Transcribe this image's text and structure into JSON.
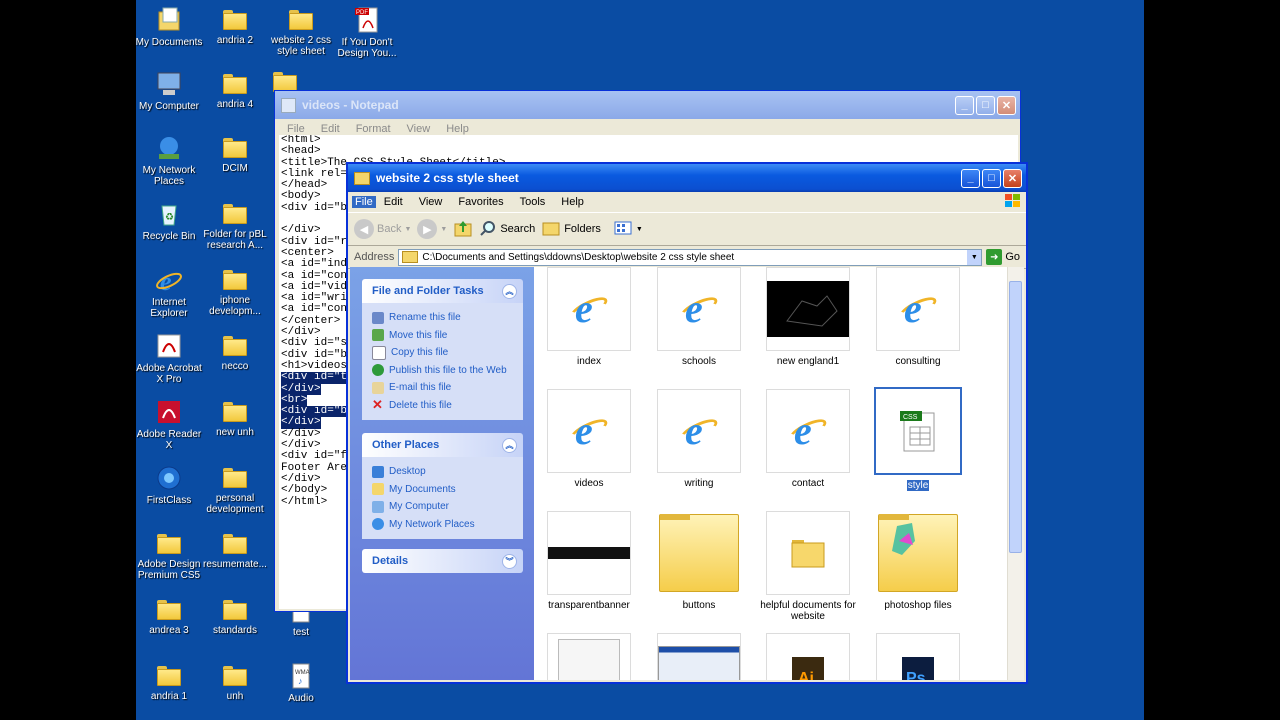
{
  "desktop_icons": [
    {
      "label": "My Documents",
      "icon": "my-documents-icon"
    },
    {
      "label": "andria 2",
      "icon": "folder-icon"
    },
    {
      "label": "website 2 css style sheet",
      "icon": "folder-icon"
    },
    {
      "label": "If You Don't Design You...",
      "icon": "pdf-icon"
    },
    {
      "label": "My Computer",
      "icon": "my-computer-icon"
    },
    {
      "label": "andria 4",
      "icon": "folder-icon"
    },
    {
      "label": "My Network Places",
      "icon": "network-icon"
    },
    {
      "label": "DCIM",
      "icon": "folder-icon"
    },
    {
      "label": "Recycle Bin",
      "icon": "recycle-bin-icon"
    },
    {
      "label": "Folder for pBL research A...",
      "icon": "folder-icon"
    },
    {
      "label": "Internet Explorer",
      "icon": "ie-icon"
    },
    {
      "label": "iphone developm...",
      "icon": "folder-icon"
    },
    {
      "label": "Adobe Acrobat X Pro",
      "icon": "acrobat-icon"
    },
    {
      "label": "necco",
      "icon": "folder-icon"
    },
    {
      "label": "Adobe Reader X",
      "icon": "reader-icon"
    },
    {
      "label": "new unh",
      "icon": "folder-icon"
    },
    {
      "label": "FirstClass",
      "icon": "firstclass-icon"
    },
    {
      "label": "personal development",
      "icon": "folder-icon"
    },
    {
      "label": "Adobe Design Premium CS5",
      "icon": "folder-icon"
    },
    {
      "label": "resumemate...",
      "icon": "folder-icon"
    },
    {
      "label": "andrea 3",
      "icon": "folder-icon"
    },
    {
      "label": "standards",
      "icon": "folder-icon"
    },
    {
      "label": "test",
      "icon": "wma-icon"
    },
    {
      "label": "andria 1",
      "icon": "folder-icon"
    },
    {
      "label": "unh",
      "icon": "folder-icon"
    },
    {
      "label": "Audio",
      "icon": "wma-icon"
    }
  ],
  "notepad": {
    "title": "videos - Notepad",
    "menu": [
      "File",
      "Edit",
      "Format",
      "View",
      "Help"
    ],
    "lines": [
      "<html>",
      "<head>",
      "<title>The CSS Style Sheet</title>",
      "<link rel=",
      "</head>",
      "<body>",
      "<div id=\"b",
      "",
      "</div>",
      "<div id=\"r",
      "<center>",
      "<a id=\"ind",
      "<a id=\"con",
      "<a id=\"vid",
      "<a id=\"wri",
      "<a id=\"con",
      "</center>",
      "</div>",
      "<div id=\"s",
      "<div id=\"b",
      "<h1>videos",
      "<div id=\"t",
      "</div>",
      "<br>",
      "<div id=\"b",
      "</div>",
      "</div>",
      "</div>",
      "<div id=\"f",
      "Footer Are",
      "</div>",
      "</body>",
      "</html>"
    ],
    "selected_lines": [
      21,
      22,
      23,
      24,
      25
    ]
  },
  "explorer": {
    "title": "website 2 css style sheet",
    "menu": [
      "File",
      "Edit",
      "View",
      "Favorites",
      "Tools",
      "Help"
    ],
    "toolbar": {
      "back": "Back",
      "search": "Search",
      "folders": "Folders"
    },
    "address_label": "Address",
    "address_value": "C:\\Documents and Settings\\ddowns\\Desktop\\website 2 css style sheet",
    "go_label": "Go",
    "file_tasks": {
      "title": "File and Folder Tasks",
      "items": [
        "Rename this file",
        "Move this file",
        "Copy this file",
        "Publish this file to the Web",
        "E-mail this file",
        "Delete this file"
      ]
    },
    "other_places": {
      "title": "Other Places",
      "items": [
        "Desktop",
        "My Documents",
        "My Computer",
        "My Network Places"
      ]
    },
    "details": {
      "title": "Details"
    },
    "files": [
      {
        "name": "index",
        "type": "html"
      },
      {
        "name": "schools",
        "type": "html"
      },
      {
        "name": "new england1",
        "type": "image-dark"
      },
      {
        "name": "consulting",
        "type": "html"
      },
      {
        "name": "videos",
        "type": "html"
      },
      {
        "name": "writing",
        "type": "html"
      },
      {
        "name": "contact",
        "type": "html"
      },
      {
        "name": "style",
        "type": "css",
        "selected": true
      },
      {
        "name": "transparentbanner",
        "type": "banner"
      },
      {
        "name": "buttons",
        "type": "folder-buttons"
      },
      {
        "name": "helpful documents for website",
        "type": "folder-small"
      },
      {
        "name": "photoshop files",
        "type": "folder-map"
      },
      {
        "name": "",
        "type": "doc-thumb"
      },
      {
        "name": "",
        "type": "screenshot-thumb"
      },
      {
        "name": "",
        "type": "ai-file"
      },
      {
        "name": "",
        "type": "psd-file"
      }
    ],
    "colors": {
      "title_active": "#0a5ae0",
      "task_pane": "#6375d6",
      "selection": "#316ac5"
    }
  }
}
